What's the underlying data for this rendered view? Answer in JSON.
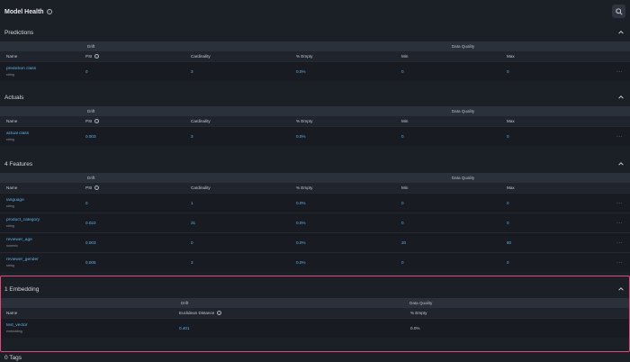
{
  "header": {
    "title": "Model Health"
  },
  "sections": {
    "predictions": {
      "title": "Predictions",
      "groups": [
        "Drift",
        "Data Quality"
      ],
      "columns": [
        "Name",
        "PSI",
        "Cardinality",
        "% Empty",
        "Min",
        "Max"
      ],
      "rows": [
        {
          "name": "prediction class",
          "type": "string",
          "psi": "0",
          "cardinality": "3",
          "empty": "0.0%",
          "min": "0",
          "max": "0"
        }
      ]
    },
    "actuals": {
      "title": "Actuals",
      "groups": [
        "Drift",
        "Data Quality"
      ],
      "columns": [
        "Name",
        "PSI",
        "Cardinality",
        "% Empty",
        "Min",
        "Max"
      ],
      "rows": [
        {
          "name": "actual class",
          "type": "string",
          "psi": "0.003",
          "cardinality": "3",
          "empty": "0.0%",
          "min": "0",
          "max": "0"
        }
      ]
    },
    "features": {
      "title": "4 Features",
      "groups": [
        "Drift",
        "Data Quality"
      ],
      "columns": [
        "Name",
        "PSI",
        "Cardinality",
        "% Empty",
        "Min",
        "Max"
      ],
      "rows": [
        {
          "name": "language",
          "type": "string",
          "psi": "0",
          "cardinality": "1",
          "empty": "0.0%",
          "min": "0",
          "max": "0"
        },
        {
          "name": "product_category",
          "type": "string",
          "psi": "0.022",
          "cardinality": "31",
          "empty": "0.0%",
          "min": "0",
          "max": "0"
        },
        {
          "name": "reviewer_age",
          "type": "numeric",
          "psi": "0.003",
          "cardinality": "0",
          "empty": "0.0%",
          "min": "20",
          "max": "80"
        },
        {
          "name": "reviewer_gender",
          "type": "string",
          "psi": "0.005",
          "cardinality": "3",
          "empty": "0.0%",
          "min": "0",
          "max": "0"
        }
      ]
    },
    "embedding": {
      "title": "1 Embedding",
      "groups": [
        "Drift",
        "Data Quality"
      ],
      "columns": [
        "Name",
        "Euclidean Distance",
        "% Empty"
      ],
      "rows": [
        {
          "name": "text_vector",
          "type": "embedding",
          "distance": "0.401",
          "empty": "0.0%"
        }
      ]
    },
    "tags": {
      "title": "0 Tags"
    }
  },
  "more_label": "···",
  "colors": {
    "accent": "#5fb3e8",
    "highlight": "#e0497a",
    "background": "#1b1f26"
  }
}
